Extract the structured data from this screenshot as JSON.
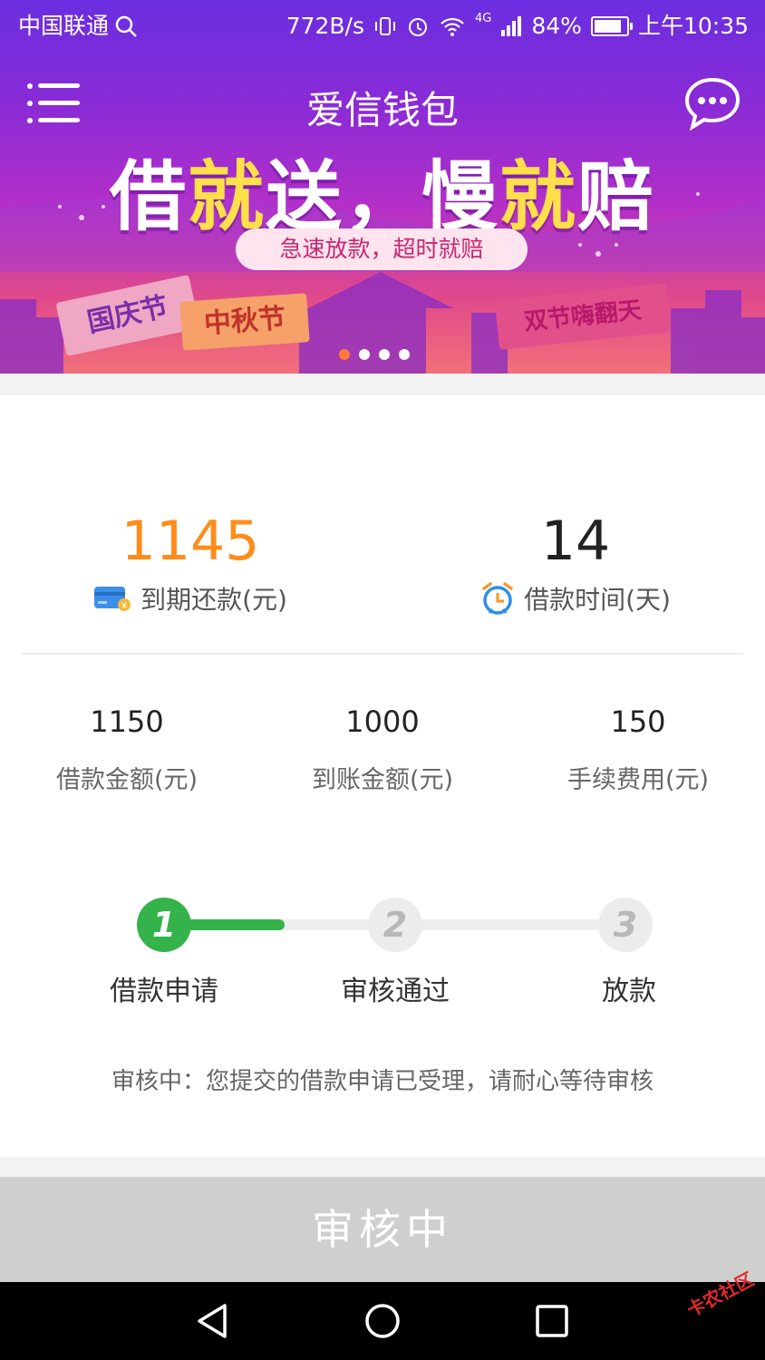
{
  "status_bar": {
    "carrier": "中国联通",
    "speed": "772B/s",
    "network": "4G",
    "battery": "84%",
    "battery_level": 0.84,
    "time": "上午10:35"
  },
  "header": {
    "title": "爱信钱包"
  },
  "banner": {
    "headline_parts": [
      "借",
      "就",
      "送，",
      "慢",
      "就",
      "赔"
    ],
    "subtitle": "急速放款，超时就赔",
    "flags": [
      "国庆节",
      "中秋节",
      "双节嗨翻天"
    ],
    "slide_count": 4,
    "active_slide": 0,
    "accent_color": "#ffe04a"
  },
  "summary": {
    "repay_amount": "1145",
    "repay_label": "到期还款(元)",
    "days_value": "14",
    "days_label": "借款时间(天)",
    "repay_color": "#ff8c1a"
  },
  "details": [
    {
      "value": "1150",
      "label": "借款金额(元)"
    },
    {
      "value": "1000",
      "label": "到账金额(元)"
    },
    {
      "value": "150",
      "label": "手续费用(元)"
    }
  ],
  "steps": {
    "items": [
      {
        "number": "1",
        "label": "借款申请",
        "done": true
      },
      {
        "number": "2",
        "label": "审核通过",
        "done": false
      },
      {
        "number": "3",
        "label": "放款",
        "done": false
      }
    ],
    "done_color": "#34b34a"
  },
  "status_message": "审核中：您提交的借款申请已受理，请耐心等待审核",
  "action_button": "审核中",
  "watermark": "卡农社区"
}
